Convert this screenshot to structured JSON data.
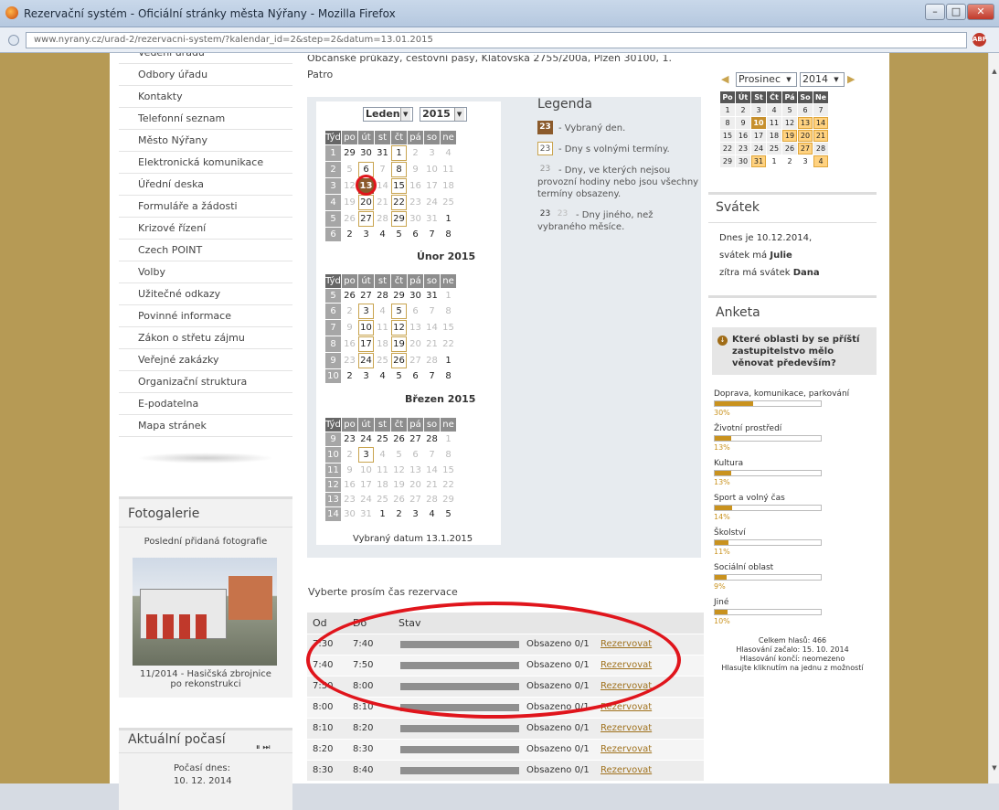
{
  "window": {
    "title": "Rezervační systém - Oficiální stránky města Nýřany - Mozilla Firefox"
  },
  "browser": {
    "url": "www.nyrany.cz/urad-2/rezervacni-system/?kalendar_id=2&step=2&datum=13.01.2015"
  },
  "menu": {
    "cut_item": "Vedení úřadu",
    "items": [
      "Odbory úřadu",
      "Kontakty",
      "Telefonní seznam",
      "Město Nýřany",
      "Elektronická komunikace",
      "Úřední deska",
      "Formuláře a žádosti",
      "Krizové řízení",
      "Czech POINT",
      "Volby",
      "Užitečné odkazy",
      "Povinné informace",
      "Zákon o střetu zájmu",
      "Veřejné zakázky",
      "Organizační struktura",
      "E-podatelna",
      "Mapa stránek"
    ]
  },
  "gallery": {
    "title": "Fotogalerie",
    "subtitle": "Poslední přidaná fotografie",
    "caption1": "11/2014 - Hasičská zbrojnice",
    "caption2": "po rekonstrukci"
  },
  "weather": {
    "title": "Aktuální počasí",
    "label": "Počasí dnes:",
    "date": "10. 12. 2014"
  },
  "center": {
    "header_line1": "Občanské průkazy, cestovní pasy, Klatovská 2755/200a, Plzeň 30100, 1.",
    "header_line2": "Patro",
    "month_select": "Leden",
    "year_select": "2015",
    "feb_title": "Únor 2015",
    "mar_title": "Březen 2015",
    "selected_date": "Vybraný datum 13.1.2015",
    "weekday_headers": [
      "Týd",
      "po",
      "út",
      "st",
      "čt",
      "pá",
      "so",
      "ne"
    ],
    "slot_prompt": "Vyberte prosím čas rezervace",
    "slot_headers": {
      "from": "Od",
      "to": "Do",
      "status": "Stav"
    }
  },
  "legend": {
    "title": "Legenda",
    "selected_num": "23",
    "selected_text": "- Vybraný den.",
    "free_num": "23",
    "free_text": "- Dny s volnými termíny.",
    "busy_num": "23",
    "busy_text": "- Dny, ve kterých nejsou provozní hodiny nebo jsou všechny termíny obsazeny.",
    "other_num1": "23",
    "other_num2": "23",
    "other_text": "- Dny jiného, než vybraného měsíce."
  },
  "slots": [
    {
      "from": "7:30",
      "to": "7:40",
      "status": "Obsazeno 0/1",
      "action": "Rezervovat"
    },
    {
      "from": "7:40",
      "to": "7:50",
      "status": "Obsazeno 0/1",
      "action": "Rezervovat"
    },
    {
      "from": "7:50",
      "to": "8:00",
      "status": "Obsazeno 0/1",
      "action": "Rezervovat"
    },
    {
      "from": "8:00",
      "to": "8:10",
      "status": "Obsazeno 0/1",
      "action": "Rezervovat"
    },
    {
      "from": "8:10",
      "to": "8:20",
      "status": "Obsazeno 0/1",
      "action": "Rezervovat"
    },
    {
      "from": "8:20",
      "to": "8:30",
      "status": "Obsazeno 0/1",
      "action": "Rezervovat"
    },
    {
      "from": "8:30",
      "to": "8:40",
      "status": "Obsazeno 0/1",
      "action": "Rezervovat"
    }
  ],
  "minical": {
    "month": "Prosinec",
    "year": "2014",
    "headers": [
      "Po",
      "Út",
      "St",
      "Čt",
      "Pá",
      "So",
      "Ne"
    ]
  },
  "holiday": {
    "title": "Svátek",
    "line1": "Dnes je 10.12.2014,",
    "line2_pre": "svátek má ",
    "line2_name": "Julie",
    "line3_pre": "zítra má svátek ",
    "line3_name": "Dana"
  },
  "poll": {
    "title": "Anketa",
    "question": "Které oblasti by se příští zastupitelstvo mělo věnovat především?",
    "options": [
      {
        "label": "Doprava, komunikace, parkování",
        "pct": "30%",
        "value": 30
      },
      {
        "label": "Životní prostředí",
        "pct": "13%",
        "value": 13
      },
      {
        "label": "Kultura",
        "pct": "13%",
        "value": 13
      },
      {
        "label": "Sport a volný čas",
        "pct": "14%",
        "value": 14
      },
      {
        "label": "Školství",
        "pct": "11%",
        "value": 11
      },
      {
        "label": "Sociální oblast",
        "pct": "9%",
        "value": 9
      },
      {
        "label": "Jiné",
        "pct": "10%",
        "value": 10
      }
    ],
    "total": "Celkem hlasů: 466",
    "started": "Hlasování začalo: 15. 10. 2014",
    "ends": "Hlasování končí: neomezeno",
    "hint": "Hlasujte kliknutím na jednu z možností"
  }
}
